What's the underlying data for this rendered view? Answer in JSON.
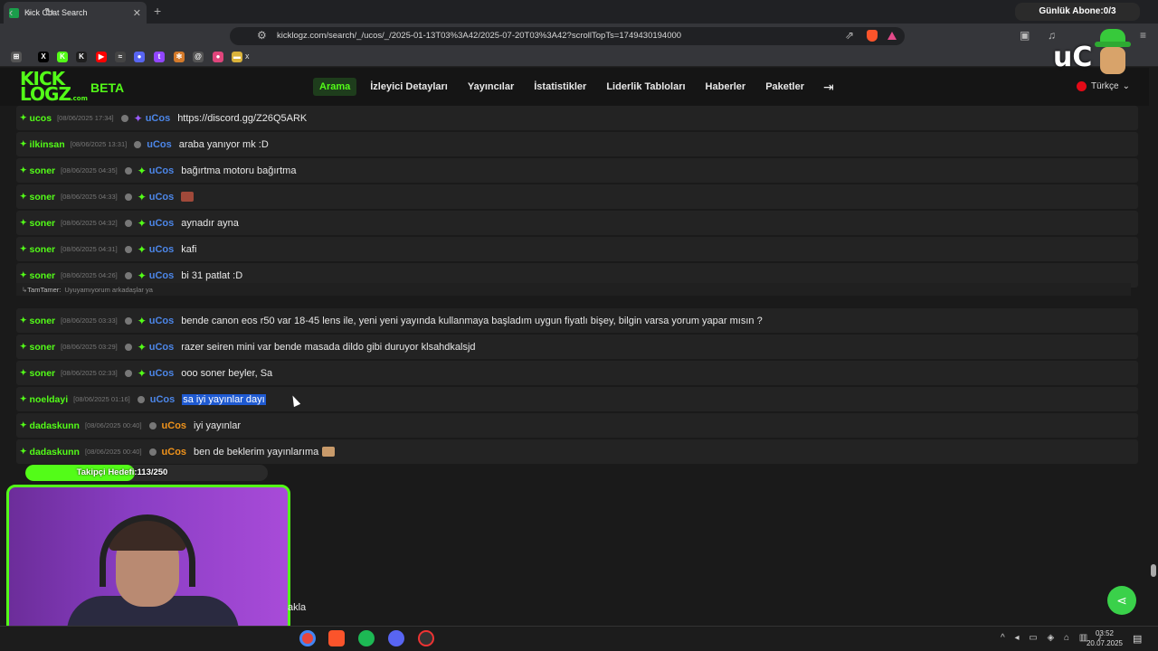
{
  "browser": {
    "tab_title": "Kick Chat Search",
    "tab_close": "✕",
    "new_tab": "+",
    "url": "kicklogz.com/search/_/ucos/_/2025-01-13T03%3A42/2025-07-20T03%3A42?scrollTopTs=1749430194000",
    "back_icon": "‹",
    "forward_icon": "›",
    "reload_icon": "↻",
    "bookmarks": [
      {
        "name": "apps-icon",
        "color": "#555555",
        "glyph": "⊞"
      },
      {
        "name": "x-icon",
        "color": "#000000",
        "glyph": "X"
      },
      {
        "name": "kick-icon",
        "color": "#53fc18",
        "glyph": "K"
      },
      {
        "name": "kick-alt-icon",
        "color": "#1e1e1e",
        "glyph": "K"
      },
      {
        "name": "youtube-icon",
        "color": "#ff0000",
        "glyph": "▶"
      },
      {
        "name": "analytics-icon",
        "color": "#444444",
        "glyph": "≈"
      },
      {
        "name": "discord-icon",
        "color": "#5865f2",
        "glyph": "●"
      },
      {
        "name": "twitch-icon",
        "color": "#9146ff",
        "glyph": "t"
      },
      {
        "name": "gear-icon",
        "color": "#d47a2a",
        "glyph": "✻"
      },
      {
        "name": "at-icon",
        "color": "#555555",
        "glyph": "@"
      },
      {
        "name": "pink-icon",
        "color": "#e0457b",
        "glyph": "●"
      },
      {
        "name": "folder-icon",
        "color": "#d9b23a",
        "glyph": "▬"
      }
    ],
    "bookmark_x_label": "x"
  },
  "stream_goal": {
    "label": "Günlük Abone:0/3"
  },
  "site": {
    "logo_top": "KICK",
    "logo_bottom": "LOGZ",
    "logo_com": ".com",
    "beta": "BETA",
    "nav": [
      "Arama",
      "İzleyici Detayları",
      "Yayıncılar",
      "İstatistikler",
      "Liderlik Tabloları",
      "Haberler",
      "Paketler"
    ],
    "login_icon": "⇥",
    "language": "Türkçe",
    "language_chevron": "⌄"
  },
  "overlay_logo": "uC",
  "chat": {
    "rows": [
      {
        "user": "ucos",
        "ts": "[08/06/2025 17:34]",
        "streamer": "uCos",
        "gem": "purple",
        "msg": "https://discord.gg/Z26Q5ARK"
      },
      {
        "user": "ilkinsan",
        "ts": "[08/06/2025 13:31]",
        "streamer": "uCos",
        "gem": "none",
        "msg": "araba yanıyor mk :D"
      },
      {
        "user": "soner",
        "ts": "[08/06/2025 04:35]",
        "streamer": "uCos",
        "gem": "green",
        "msg": "bağırtma motoru bağırtma"
      },
      {
        "user": "soner",
        "ts": "[08/06/2025 04:33]",
        "streamer": "uCos",
        "gem": "green",
        "msg": "",
        "emote": true
      },
      {
        "user": "soner",
        "ts": "[08/06/2025 04:32]",
        "streamer": "uCos",
        "gem": "green",
        "msg": "aynadır ayna"
      },
      {
        "user": "soner",
        "ts": "[08/06/2025 04:31]",
        "streamer": "uCos",
        "gem": "green",
        "msg": "kafi"
      },
      {
        "user": "soner",
        "ts": "[08/06/2025 04:26]",
        "streamer": "uCos",
        "gem": "green",
        "msg": "bi 31 patlat :D"
      },
      {
        "user": "soner",
        "ts": "[08/06/2025 03:33]",
        "streamer": "uCos",
        "gem": "green",
        "msg": "bende canon eos r50 var 18-45 lens ile, yeni yeni yayında kullanmaya başladım uygun fiyatlı bişey, bilgin varsa yorum yapar mısın ?"
      },
      {
        "user": "soner",
        "ts": "[08/06/2025 03:29]",
        "streamer": "uCos",
        "gem": "green",
        "msg": "razer seiren mini var bende masada dildo gibi duruyor klsahdkalsjd"
      },
      {
        "user": "soner",
        "ts": "[08/06/2025 02:33]",
        "streamer": "uCos",
        "gem": "green",
        "msg": "ooo soner beyler, Sa"
      },
      {
        "user": "noeldayi",
        "ts": "[08/06/2025 01:16]",
        "streamer": "uCos",
        "gem": "none",
        "msg": "sa iyi yayınlar dayı",
        "selected": true
      },
      {
        "user": "dadaskunn",
        "ts": "[08/06/2025 00:40]",
        "streamer": "uCos",
        "gem": "none",
        "streamer_color": "orange",
        "msg": "iyi yayınlar"
      },
      {
        "user": "dadaskunn",
        "ts": "[08/06/2025 00:40]",
        "streamer": "uCos",
        "gem": "none",
        "streamer_color": "orange",
        "msg": "ben de beklerim yayınlarıma",
        "emote_after": true
      }
    ],
    "reply": {
      "user": "TamTamer:",
      "text": "Uyuyamıyorum arkadaşlar ya"
    }
  },
  "follow_goal": {
    "label": "Takipçi Hedefi:113/250",
    "current": 113,
    "target": 250
  },
  "partial_text": "akla",
  "share_icon": "⋖",
  "taskbar": {
    "time": "03:52",
    "date": "20.07.2025",
    "tray_icons": "^ ◂ ▭ ◈ ⌂ ▥ ♪",
    "notification_icon": "▤"
  }
}
